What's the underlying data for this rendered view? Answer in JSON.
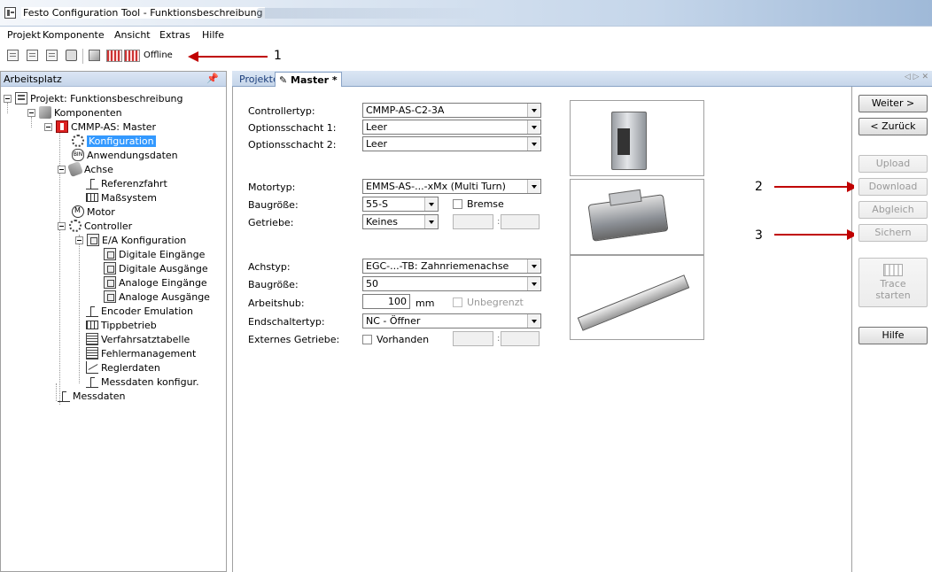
{
  "window": {
    "title": "Festo Configuration Tool - Funktionsbeschreibung"
  },
  "menu": {
    "items": [
      "Projekt",
      "Komponente",
      "Ansicht",
      "Extras",
      "Hilfe"
    ]
  },
  "toolbar": {
    "status_label": "Offline"
  },
  "annotations": {
    "marker_1": "1",
    "marker_2": "2",
    "marker_3": "3",
    "arrow_color": "#c00000"
  },
  "workspace": {
    "title": "Arbeitsplatz",
    "pin_icon": "pin-icon",
    "tree": [
      {
        "label": "Projekt: Funktionsbeschreibung",
        "icon": "project-icon"
      },
      {
        "label": "Komponenten",
        "icon": "components-icon"
      },
      {
        "label": "CMMP-AS: Master",
        "icon": "controller-device-icon"
      },
      {
        "label": "Konfiguration",
        "icon": "configuration-icon",
        "selected": true
      },
      {
        "label": "Anwendungsdaten",
        "icon": "application-data-icon"
      },
      {
        "label": "Achse",
        "icon": "axis-icon"
      },
      {
        "label": "Referenzfahrt",
        "icon": "homing-icon"
      },
      {
        "label": "Maßsystem",
        "icon": "measuring-system-icon"
      },
      {
        "label": "Motor",
        "icon": "motor-icon"
      },
      {
        "label": "Controller",
        "icon": "controller-icon"
      },
      {
        "label": "E/A Konfiguration",
        "icon": "io-config-icon"
      },
      {
        "label": "Digitale Eingänge",
        "icon": "io-icon"
      },
      {
        "label": "Digitale Ausgänge",
        "icon": "io-icon"
      },
      {
        "label": "Analoge Eingänge",
        "icon": "io-icon"
      },
      {
        "label": "Analoge Ausgänge",
        "icon": "io-icon"
      },
      {
        "label": "Encoder Emulation",
        "icon": "encoder-icon"
      },
      {
        "label": "Tippbetrieb",
        "icon": "jog-icon"
      },
      {
        "label": "Verfahrsatztabelle",
        "icon": "record-table-icon"
      },
      {
        "label": "Fehlermanagement",
        "icon": "error-management-icon"
      },
      {
        "label": "Reglerdaten",
        "icon": "controller-data-icon"
      },
      {
        "label": "Messdaten konfigur.",
        "icon": "measurement-config-icon"
      },
      {
        "label": "Messdaten",
        "icon": "measurement-icon"
      }
    ]
  },
  "tabs": {
    "projekte": "Projekte",
    "master": "Master *"
  },
  "form": {
    "controllertyp_label": "Controllertyp:",
    "controllertyp_value": "CMMP-AS-C2-3A",
    "optionsschacht1_label": "Optionsschacht 1:",
    "optionsschacht1_value": "Leer",
    "optionsschacht2_label": "Optionsschacht 2:",
    "optionsschacht2_value": "Leer",
    "motortyp_label": "Motortyp:",
    "motortyp_value": "EMMS-AS-...-xMx (Multi Turn)",
    "motor_baugroesse_label": "Baugröße:",
    "motor_baugroesse_value": "55-S",
    "bremse_label": "Bremse",
    "getriebe_label": "Getriebe:",
    "getriebe_value": "Keines",
    "ratio_separator": ":",
    "achstyp_label": "Achstyp:",
    "achstyp_value": "EGC-...-TB: Zahnriemenachse",
    "achs_baugroesse_label": "Baugröße:",
    "achs_baugroesse_value": "50",
    "arbeitshub_label": "Arbeitshub:",
    "arbeitshub_value": "100",
    "arbeitshub_unit": "mm",
    "unbegrenzt_label": "Unbegrenzt",
    "endschaltertyp_label": "Endschaltertyp:",
    "endschaltertyp_value": "NC - Öffner",
    "externes_getriebe_label": "Externes Getriebe:",
    "vorhanden_label": "Vorhanden"
  },
  "buttons": {
    "weiter": "Weiter >",
    "zurueck": "< Zurück",
    "upload": "Upload",
    "download": "Download",
    "abgleich": "Abgleich",
    "sichern": "Sichern",
    "trace_line1": "Trace",
    "trace_line2": "starten",
    "hilfe": "Hilfe"
  }
}
